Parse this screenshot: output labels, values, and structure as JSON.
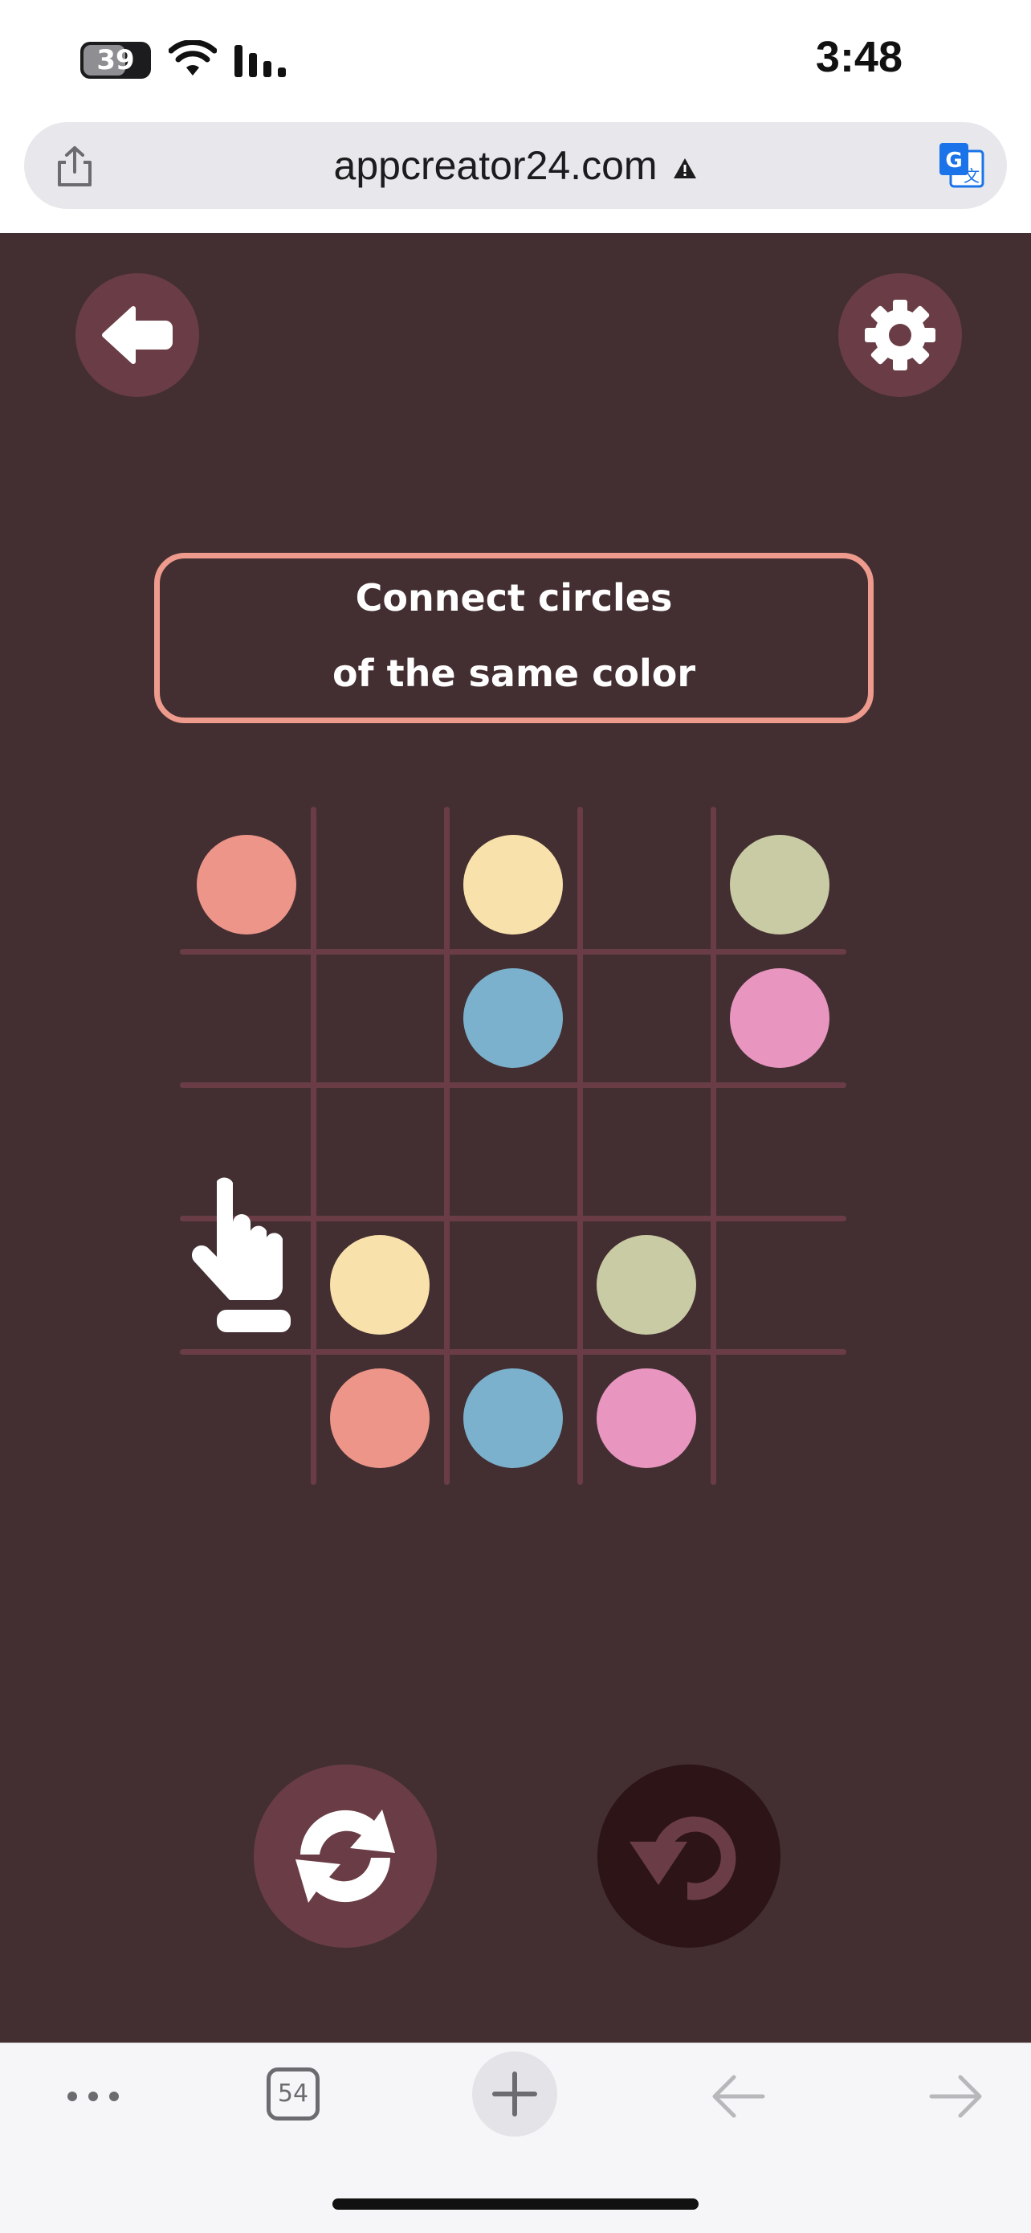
{
  "status_bar": {
    "battery_level": "39",
    "time": "3:48",
    "icons": [
      "battery-icon",
      "wifi-icon",
      "cellular-signal-icon"
    ]
  },
  "browser": {
    "url": "appcreator24.com",
    "security_icon": "warning-icon",
    "share_icon": "share-icon",
    "translate_icon": "translate-icon"
  },
  "game": {
    "instruction": {
      "line1": "Connect circles",
      "line2": "of the same color"
    },
    "top_buttons": [
      "back-arrow-icon",
      "gear-icon"
    ],
    "bottom_buttons": [
      "shuffle-icon",
      "undo-icon"
    ],
    "grid": {
      "rows": 5,
      "cols": 5,
      "cells": [
        [
          {
            "c": "#ee958a"
          },
          null,
          {
            "c": "#f8e1ab"
          },
          null,
          {
            "c": "#c9cba5"
          }
        ],
        [
          null,
          null,
          {
            "c": "#7bb1cd"
          },
          null,
          {
            "c": "#e896c0"
          }
        ],
        [
          null,
          null,
          null,
          null,
          null
        ],
        [
          null,
          {
            "c": "#f8e1ab"
          },
          null,
          {
            "c": "#c9cba5"
          },
          null
        ],
        [
          null,
          {
            "c": "#ee958a"
          },
          {
            "c": "#7bb1cd"
          },
          {
            "c": "#e896c0"
          },
          null
        ]
      ]
    },
    "colors": {
      "background": "#432f31",
      "accent": "#6a3d46",
      "border": "#ee9b8e",
      "undo_disabled": "#2d1416"
    },
    "tutorial_hand_icon": "pointing-hand-icon"
  },
  "toolbar": {
    "tabs_count": "54",
    "items": [
      "more-icon",
      "tabs-icon",
      "new-tab-icon",
      "back-icon",
      "forward-icon"
    ]
  }
}
